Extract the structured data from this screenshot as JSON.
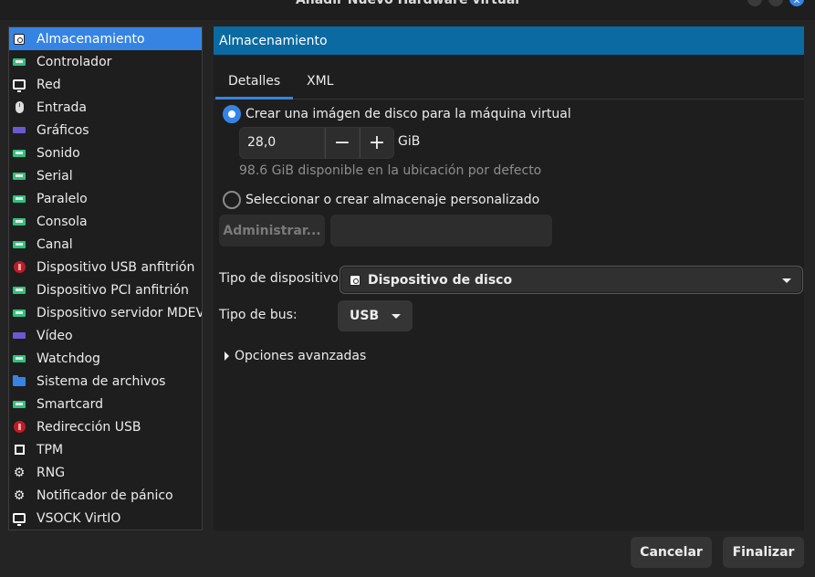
{
  "window": {
    "title": "Añadir Nuevo Hardware virtual"
  },
  "sidebar": {
    "items": [
      {
        "label": "Almacenamiento",
        "icon": "disk-icon",
        "selected": true
      },
      {
        "label": "Controlador",
        "icon": "card-icon"
      },
      {
        "label": "Red",
        "icon": "monitor-icon"
      },
      {
        "label": "Entrada",
        "icon": "mouse-icon"
      },
      {
        "label": "Gráficos",
        "icon": "gpu-icon"
      },
      {
        "label": "Sonido",
        "icon": "card-icon"
      },
      {
        "label": "Serial",
        "icon": "card-icon"
      },
      {
        "label": "Paralelo",
        "icon": "card-icon"
      },
      {
        "label": "Consola",
        "icon": "card-icon"
      },
      {
        "label": "Canal",
        "icon": "card-icon"
      },
      {
        "label": "Dispositivo USB anfitrión",
        "icon": "usb-icon"
      },
      {
        "label": "Dispositivo PCI anfitrión",
        "icon": "card-icon"
      },
      {
        "label": "Dispositivo servidor MDEV",
        "icon": "card-icon"
      },
      {
        "label": "Vídeo",
        "icon": "gpu-icon"
      },
      {
        "label": "Watchdog",
        "icon": "card-icon"
      },
      {
        "label": "Sistema de archivos",
        "icon": "folder-icon"
      },
      {
        "label": "Smartcard",
        "icon": "card-icon"
      },
      {
        "label": "Redirección USB",
        "icon": "usb-icon"
      },
      {
        "label": "TPM",
        "icon": "tpm-icon"
      },
      {
        "label": "RNG",
        "icon": "gear-icon"
      },
      {
        "label": "Notificador de pánico",
        "icon": "gear-icon"
      },
      {
        "label": "VSOCK VirtIO",
        "icon": "monitor-icon"
      }
    ]
  },
  "pane": {
    "header": "Almacenamiento",
    "tabs": [
      {
        "label": "Detalles",
        "active": true
      },
      {
        "label": "XML",
        "active": false
      }
    ],
    "radio_create": "Crear una imágen de disco para la máquina virtual",
    "size_value": "28,0",
    "size_unit": "GiB",
    "available_hint": "98.6 GiB disponible en la ubicación por defecto",
    "radio_custom": "Seleccionar o crear almacenaje personalizado",
    "manage_button": "Administrar...",
    "path_value": "",
    "device_type_label": "Tipo de dispositivo:",
    "device_type_value": "Dispositivo de disco",
    "bus_type_label": "Tipo de bus:",
    "bus_type_value": "USB",
    "advanced_options": "Opciones avanzadas"
  },
  "footer": {
    "cancel": "Cancelar",
    "finish": "Finalizar"
  },
  "colors": {
    "accent": "#3584e4",
    "header": "#0a6aa1",
    "background": "#242424"
  }
}
